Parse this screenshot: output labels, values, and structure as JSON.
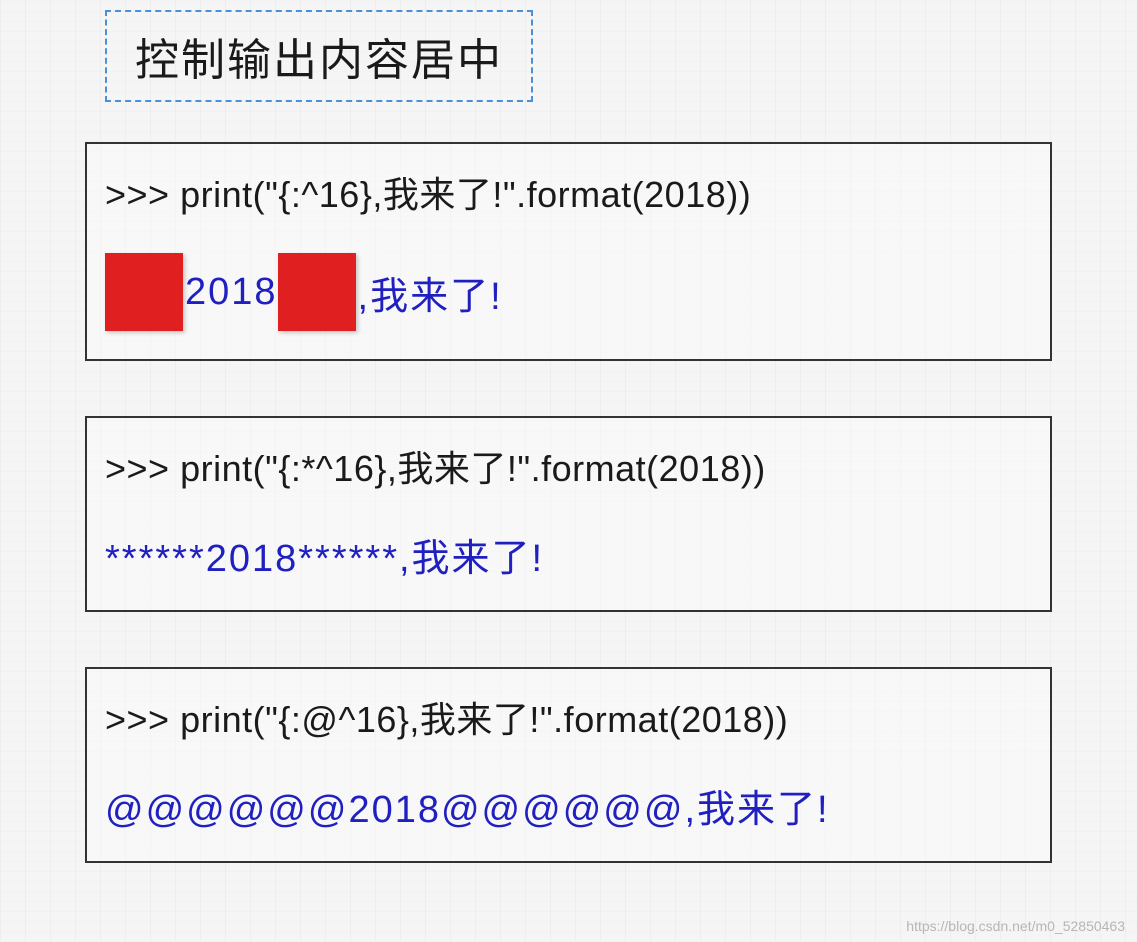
{
  "title": "控制输出内容居中",
  "examples": [
    {
      "code": ">>> print(\"{:^16},我来了!\".format(2018))",
      "output_segments": [
        {
          "type": "redbox"
        },
        {
          "type": "text",
          "value": "2018"
        },
        {
          "type": "redbox"
        },
        {
          "type": "text",
          "value": ",我来了!"
        }
      ]
    },
    {
      "code": ">>> print(\"{:*^16},我来了!\".format(2018))",
      "output_segments": [
        {
          "type": "text",
          "value": "******2018******,我来了!"
        }
      ]
    },
    {
      "code": ">>> print(\"{:@^16},我来了!\".format(2018))",
      "output_segments": [
        {
          "type": "text",
          "value": "@@@@@@2018@@@@@@,我来了!"
        }
      ]
    }
  ],
  "watermark": "https://blog.csdn.net/m0_52850463"
}
